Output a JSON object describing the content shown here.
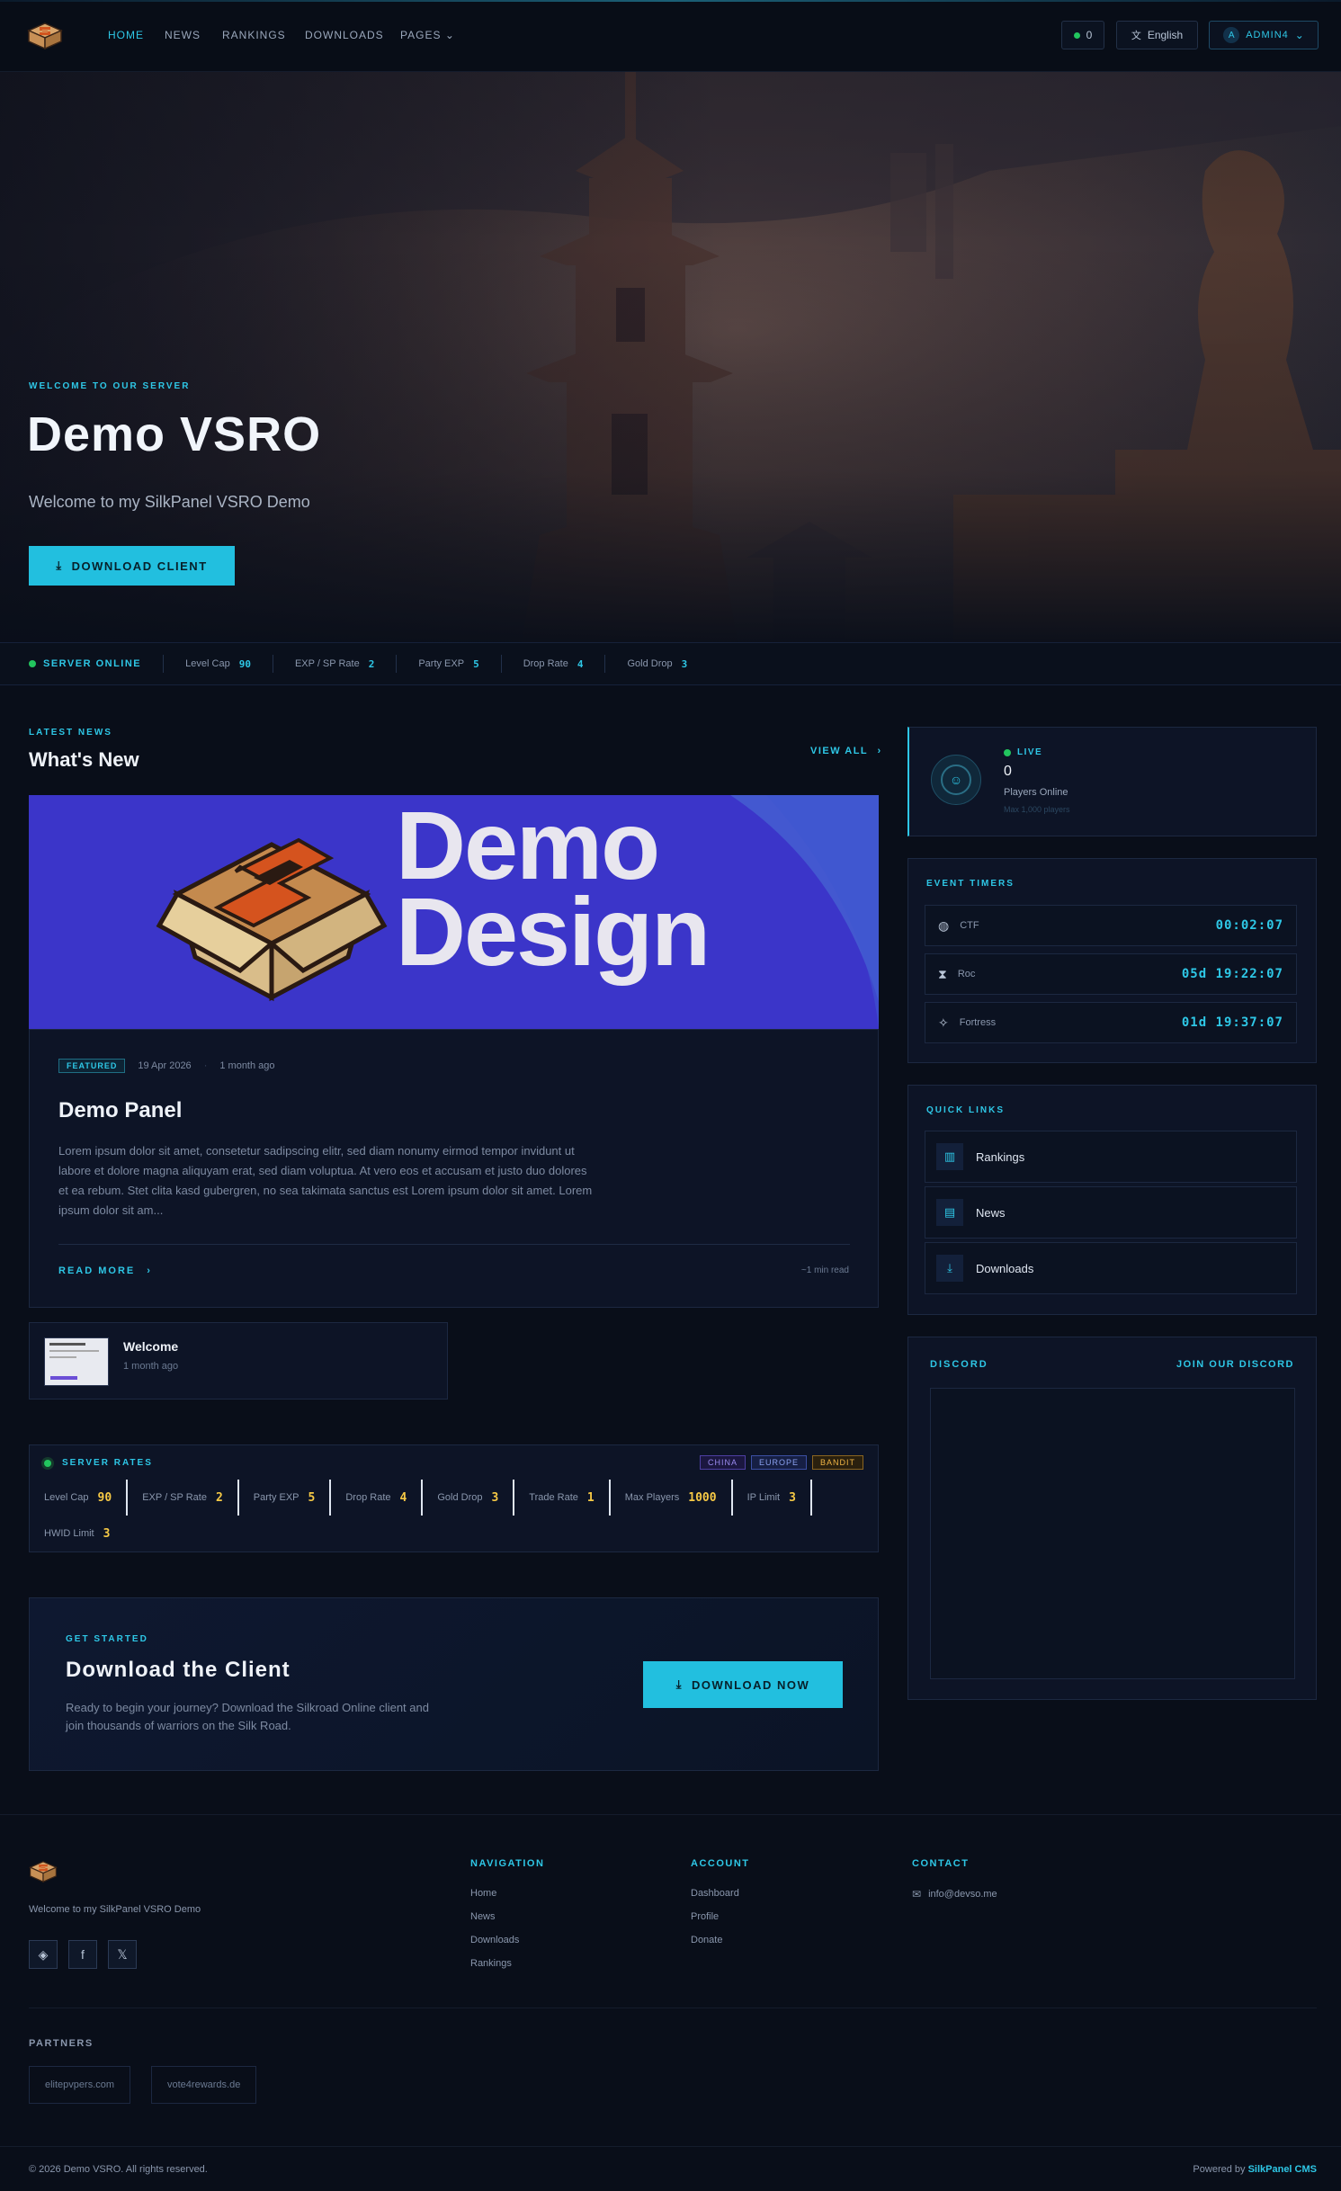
{
  "nav": {
    "items": [
      "HOME",
      "NEWS",
      "RANKINGS",
      "DOWNLOADS",
      "PAGES"
    ],
    "online_count": "0",
    "language": "English",
    "user": "ADMIN4",
    "user_initial": "A"
  },
  "hero": {
    "eyebrow": "WELCOME TO OUR SERVER",
    "title": "Demo VSRO",
    "subtitle": "Welcome to my SilkPanel VSRO Demo",
    "cta": "DOWNLOAD CLIENT"
  },
  "stats_bar": {
    "status": "SERVER ONLINE",
    "items": [
      {
        "label": "Level Cap",
        "value": "90"
      },
      {
        "label": "EXP / SP Rate",
        "value": "2"
      },
      {
        "label": "Party EXP",
        "value": "5"
      },
      {
        "label": "Drop Rate",
        "value": "4"
      },
      {
        "label": "Gold Drop",
        "value": "3"
      }
    ]
  },
  "news": {
    "eyebrow": "LATEST NEWS",
    "title": "What's New",
    "view_all": "VIEW ALL",
    "banner_line1": "Demo",
    "banner_line2": "Design",
    "featured": {
      "tag": "FEATURED",
      "date": "19 Apr 2026",
      "ago": "1 month ago",
      "title": "Demo Panel",
      "excerpt": "Lorem ipsum dolor sit amet, consetetur sadipscing elitr, sed diam nonumy eirmod tempor invidunt ut labore et dolore magna aliquyam erat, sed diam voluptua. At vero eos et accusam et justo duo dolores et ea rebum. Stet clita kasd gubergren, no sea takimata sanctus est Lorem ipsum dolor sit amet. Lorem ipsum dolor sit am...",
      "read_more": "READ MORE",
      "read_time": "~1 min read"
    },
    "small": {
      "title": "Welcome",
      "ago": "1 month ago"
    }
  },
  "server_rates": {
    "title": "SERVER RATES",
    "tags": [
      "CHINA",
      "EUROPE",
      "BANDIT"
    ],
    "items": [
      {
        "label": "Level Cap",
        "value": "90"
      },
      {
        "label": "EXP / SP Rate",
        "value": "2"
      },
      {
        "label": "Party EXP",
        "value": "5"
      },
      {
        "label": "Drop Rate",
        "value": "4"
      },
      {
        "label": "Gold Drop",
        "value": "3"
      },
      {
        "label": "Trade Rate",
        "value": "1"
      },
      {
        "label": "Max Players",
        "value": "1000"
      },
      {
        "label": "IP Limit",
        "value": "3"
      },
      {
        "label": "HWID Limit",
        "value": "3"
      }
    ]
  },
  "download": {
    "eyebrow": "GET STARTED",
    "title": "Download the Client",
    "text1": "Ready to begin your journey? Download the Silkroad Online client and",
    "text2": "join thousands of warriors on the Silk Road.",
    "button": "DOWNLOAD NOW"
  },
  "live": {
    "tag": "LIVE",
    "count": "0",
    "label": "Players Online",
    "max": "Max 1,000 players"
  },
  "timers": {
    "title": "EVENT TIMERS",
    "items": [
      {
        "name": "CTF",
        "value": "00:02:07"
      },
      {
        "name": "Roc",
        "value": "05d 19:22:07"
      },
      {
        "name": "Fortress",
        "value": "01d 19:37:07"
      }
    ]
  },
  "quick_links": {
    "title": "QUICK LINKS",
    "items": [
      "Rankings",
      "News",
      "Downloads"
    ]
  },
  "discord": {
    "title": "DISCORD",
    "join": "JOIN OUR DISCORD"
  },
  "footer": {
    "tagline": "Welcome to my SilkPanel VSRO Demo",
    "nav_title": "NAVIGATION",
    "nav_items": [
      "Home",
      "News",
      "Downloads",
      "Rankings"
    ],
    "account_title": "ACCOUNT",
    "account_items": [
      "Dashboard",
      "Profile",
      "Donate"
    ],
    "contact_title": "CONTACT",
    "email": "info@devso.me",
    "partners_title": "PARTNERS",
    "partners": [
      "elitepvpers.com",
      "vote4rewards.de"
    ],
    "copyright": "© 2026 Demo VSRO. All rights reserved.",
    "powered_prefix": "Powered by",
    "powered_brand": "SilkPanel CMS"
  },
  "colors": {
    "accent": "#2ec7e6",
    "bg": "#090e19",
    "card": "#0d1426",
    "rate_value": "#f6c945",
    "banner": "#3b35c9"
  }
}
